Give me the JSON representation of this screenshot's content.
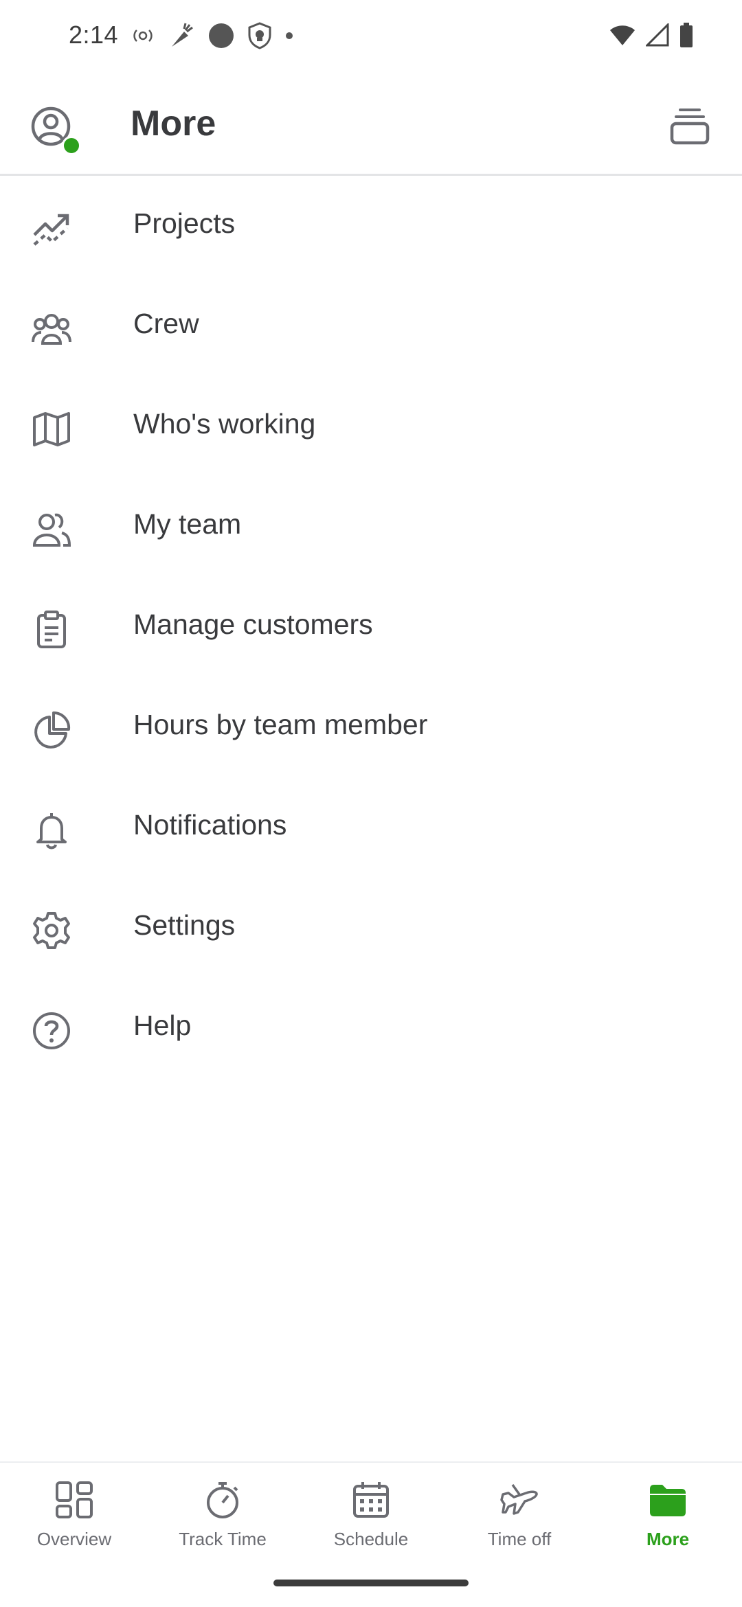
{
  "status_bar": {
    "time": "2:14",
    "left_icons": [
      "hotspot-icon",
      "carrot-icon",
      "record-icon",
      "shield-icon",
      "dot-icon"
    ],
    "right_icons": [
      "wifi-icon",
      "cellular-icon",
      "battery-icon"
    ]
  },
  "header": {
    "title": "More",
    "avatar_icon": "user-circle-icon",
    "action_icon": "stack-icon",
    "online_color": "#2ca01c"
  },
  "menu": {
    "items": [
      {
        "label": "Projects",
        "icon": "trending-up-icon"
      },
      {
        "label": "Crew",
        "icon": "crew-icon"
      },
      {
        "label": "Who's working",
        "icon": "map-icon"
      },
      {
        "label": "My team",
        "icon": "team-icon"
      },
      {
        "label": "Manage customers",
        "icon": "clipboard-icon"
      },
      {
        "label": "Hours by team member",
        "icon": "pie-chart-icon"
      },
      {
        "label": "Notifications",
        "icon": "bell-icon"
      },
      {
        "label": "Settings",
        "icon": "gear-icon"
      },
      {
        "label": "Help",
        "icon": "help-icon"
      }
    ]
  },
  "bottom_nav": {
    "items": [
      {
        "label": "Overview",
        "icon": "grid-icon"
      },
      {
        "label": "Track Time",
        "icon": "stopwatch-icon"
      },
      {
        "label": "Schedule",
        "icon": "calendar-icon"
      },
      {
        "label": "Time off",
        "icon": "airplane-icon"
      },
      {
        "label": "More",
        "icon": "folder-icon"
      }
    ],
    "active": "More",
    "active_color": "#2ca01c",
    "inactive_color": "#6b6c72"
  }
}
